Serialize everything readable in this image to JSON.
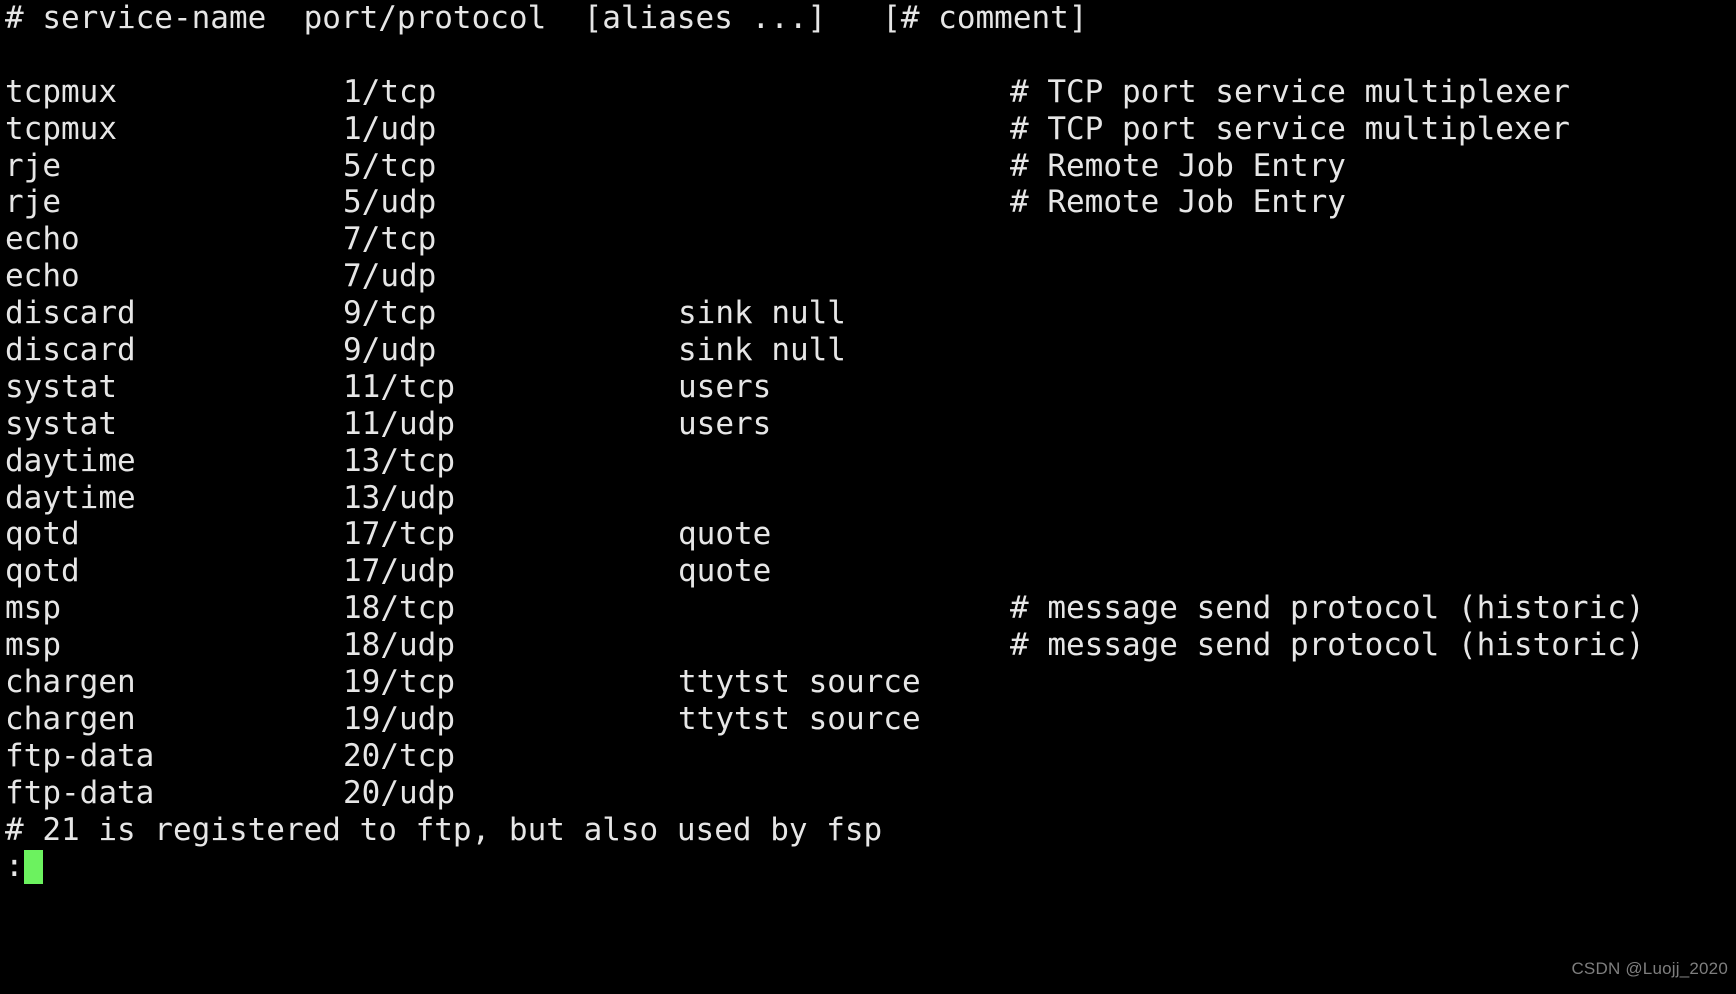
{
  "terminal": {
    "background_color": "#000000",
    "text_color": "#e6e6e6",
    "cursor_color": "#6cf25f",
    "header_line": "# service-name  port/protocol  [aliases ...]   [# comment]",
    "prompt": ":",
    "cursor": " ",
    "trailing_comment_line": "# 21 is registered to ftp, but also used by fsp"
  },
  "columns": {
    "service": "service-name",
    "port": "port/protocol",
    "aliases": "[aliases ...]",
    "comment": "[# comment]"
  },
  "rows": [
    {
      "service": "tcpmux",
      "port": "1/tcp",
      "alias": "",
      "comment": "# TCP port service multiplexer"
    },
    {
      "service": "tcpmux",
      "port": "1/udp",
      "alias": "",
      "comment": "# TCP port service multiplexer"
    },
    {
      "service": "rje",
      "port": "5/tcp",
      "alias": "",
      "comment": "# Remote Job Entry"
    },
    {
      "service": "rje",
      "port": "5/udp",
      "alias": "",
      "comment": "# Remote Job Entry"
    },
    {
      "service": "echo",
      "port": "7/tcp",
      "alias": "",
      "comment": ""
    },
    {
      "service": "echo",
      "port": "7/udp",
      "alias": "",
      "comment": ""
    },
    {
      "service": "discard",
      "port": "9/tcp",
      "alias": "sink null",
      "comment": ""
    },
    {
      "service": "discard",
      "port": "9/udp",
      "alias": "sink null",
      "comment": ""
    },
    {
      "service": "systat",
      "port": "11/tcp",
      "alias": "users",
      "comment": ""
    },
    {
      "service": "systat",
      "port": "11/udp",
      "alias": "users",
      "comment": ""
    },
    {
      "service": "daytime",
      "port": "13/tcp",
      "alias": "",
      "comment": ""
    },
    {
      "service": "daytime",
      "port": "13/udp",
      "alias": "",
      "comment": ""
    },
    {
      "service": "qotd",
      "port": "17/tcp",
      "alias": "quote",
      "comment": ""
    },
    {
      "service": "qotd",
      "port": "17/udp",
      "alias": "quote",
      "comment": ""
    },
    {
      "service": "msp",
      "port": "18/tcp",
      "alias": "",
      "comment": "# message send protocol (historic)"
    },
    {
      "service": "msp",
      "port": "18/udp",
      "alias": "",
      "comment": "# message send protocol (historic)"
    },
    {
      "service": "chargen",
      "port": "19/tcp",
      "alias": "ttytst source",
      "comment": ""
    },
    {
      "service": "chargen",
      "port": "19/udp",
      "alias": "ttytst source",
      "comment": ""
    },
    {
      "service": "ftp-data",
      "port": "20/tcp",
      "alias": "",
      "comment": ""
    },
    {
      "service": "ftp-data",
      "port": "20/udp",
      "alias": "",
      "comment": ""
    }
  ],
  "watermark": {
    "text": "CSDN @Luojj_2020"
  }
}
